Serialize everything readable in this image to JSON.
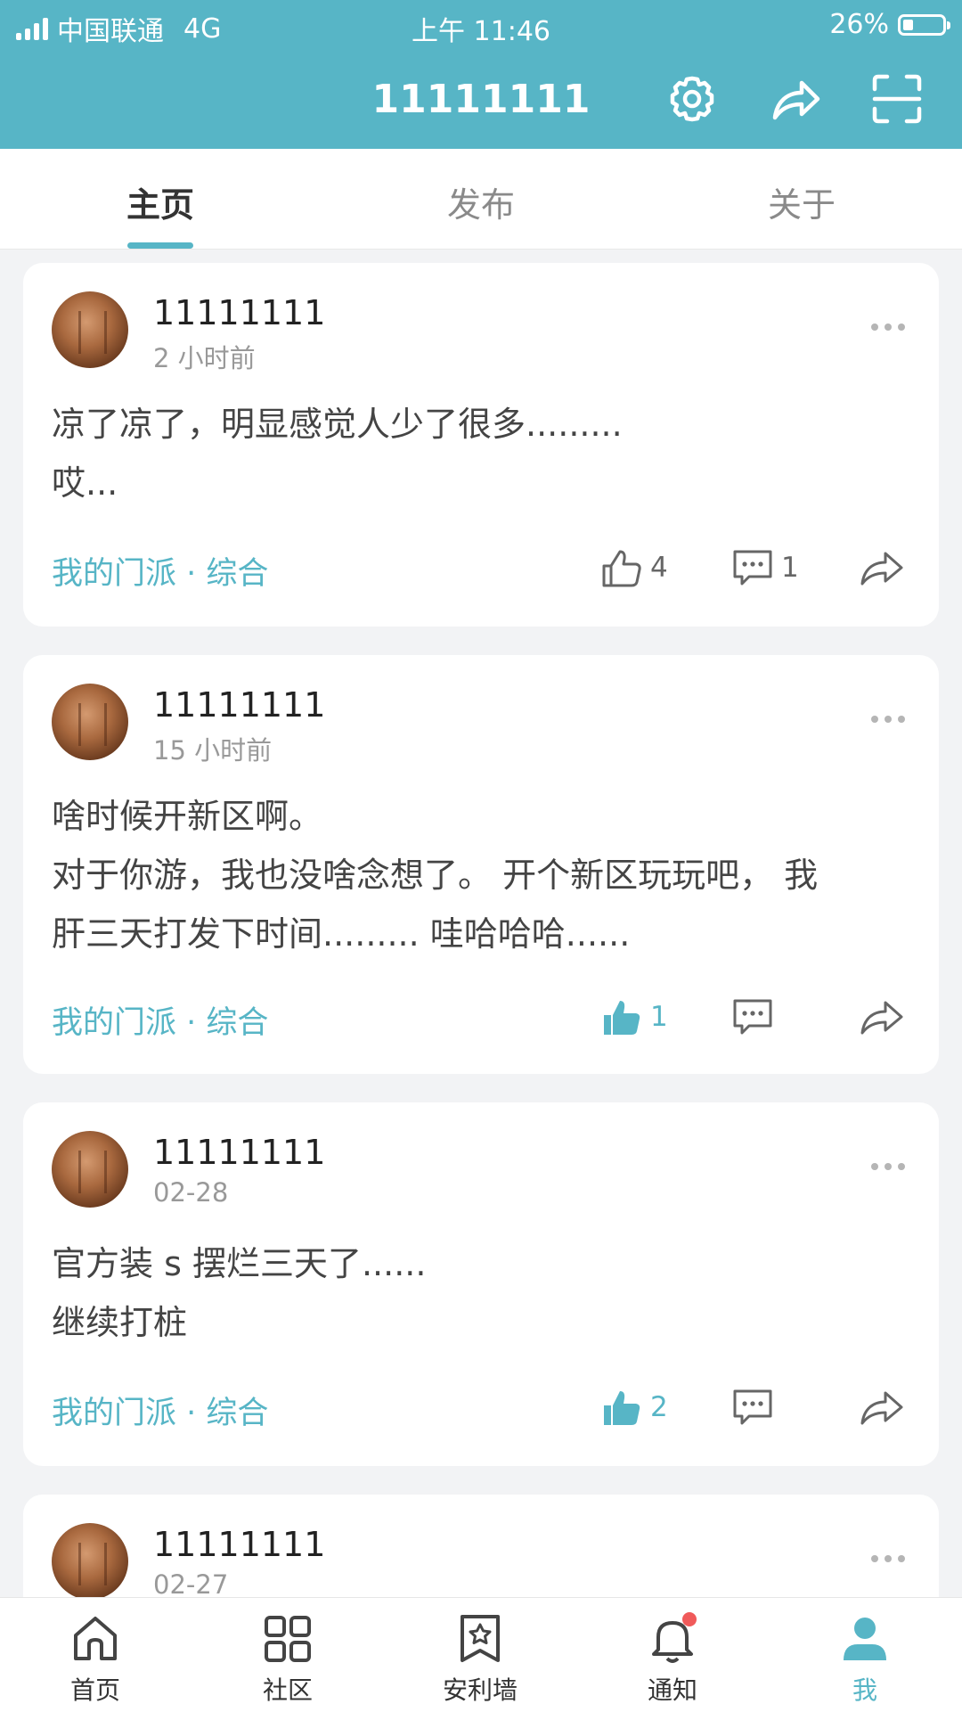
{
  "status_bar": {
    "carrier": "中国联通",
    "network": "4G",
    "time": "上午 11:46",
    "battery": "26%",
    "battery_level": 0.26
  },
  "header": {
    "title": "11111111",
    "icons": [
      "gear-icon",
      "share-icon",
      "scan-icon"
    ]
  },
  "tabs": [
    {
      "label": "主页",
      "active": true
    },
    {
      "label": "发布",
      "active": false
    },
    {
      "label": "关于",
      "active": false
    }
  ],
  "posts": [
    {
      "username": "11111111",
      "time": "2 小时前",
      "content": "凉了凉了，明显感觉人少了很多.........\n哎...",
      "tag": "我的门派 · 综合",
      "likes": "4",
      "comments": "1",
      "liked": false
    },
    {
      "username": "11111111",
      "time": "15 小时前",
      "content": "啥时候开新区啊。\n对于你游，我也没啥念想了。 开个新区玩玩吧， 我\n肝三天打发下时间......... 哇哈哈哈......",
      "tag": "我的门派 · 综合",
      "likes": "1",
      "comments": "",
      "liked": true
    },
    {
      "username": "11111111",
      "time": "02-28",
      "content": "官方装 s 摆烂三天了......\n继续打桩",
      "tag": "我的门派 · 综合",
      "likes": "2",
      "comments": "",
      "liked": true
    },
    {
      "username": "11111111",
      "time": "02-27",
      "content": "",
      "tag": "",
      "likes": "",
      "comments": "",
      "liked": false
    }
  ],
  "bottom_nav": [
    {
      "label": "首页",
      "icon": "home-icon"
    },
    {
      "label": "社区",
      "icon": "grid-icon"
    },
    {
      "label": "安利墙",
      "icon": "bookmark-star-icon"
    },
    {
      "label": "通知",
      "icon": "bell-icon",
      "badge": true
    },
    {
      "label": "我",
      "icon": "user-icon",
      "active": true
    }
  ],
  "colors": {
    "accent": "#57b5c6",
    "badge": "#f05a5a",
    "background": "#f2f3f5"
  }
}
